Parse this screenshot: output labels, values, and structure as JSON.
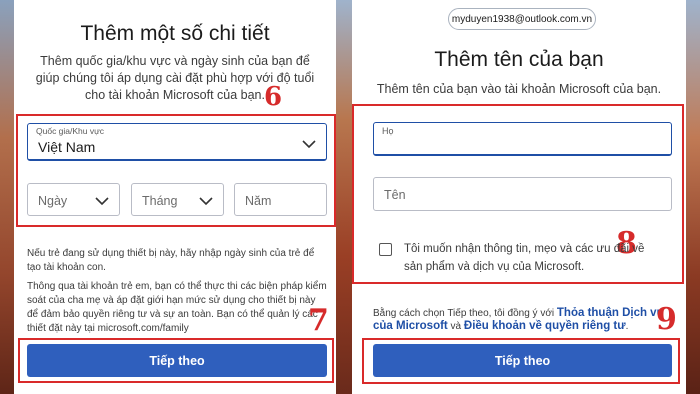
{
  "left": {
    "title": "Thêm một số chi tiết",
    "description": "Thêm quốc gia/khu vực và ngày sinh của bạn để giúp chúng tôi áp dụng cài đặt phù hợp với độ tuổi cho tài khoản Microsoft của bạn.",
    "country_label": "Quốc gia/Khu vực",
    "country_value": "Việt Nam",
    "day_placeholder": "Ngày",
    "month_placeholder": "Tháng",
    "year_placeholder": "Năm",
    "note1": "Nếu trẻ đang sử dụng thiết bị này, hãy nhập ngày sinh của trẻ để tạo tài khoản con.",
    "note2": "Thông qua tài khoản trẻ em, bạn có thể thực thi các biện pháp kiểm soát của cha mẹ và áp đặt giới hạn mức sử dụng cho thiết bị này để đảm bảo quyền riêng tư và sự an toàn. Bạn có thể quản lý các thiết đặt này tại microsoft.com/family",
    "next_button": "Tiếp theo",
    "step_a": "6",
    "step_b": "7"
  },
  "right": {
    "email": "myduyen1938@outlook.com.vn",
    "title": "Thêm tên của bạn",
    "description": "Thêm tên của bạn vào tài khoản Microsoft của bạn.",
    "last_name_placeholder": "Họ",
    "first_name_placeholder": "Tên",
    "checkbox_label": "Tôi muốn nhận thông tin, mẹo và các ưu đãi về sản phẩm và dịch vụ của Microsoft.",
    "terms_prefix": "Bằng cách chọn Tiếp theo, tôi đồng ý với ",
    "terms_link": "Thỏa thuận Dịch vụ của Microsoft",
    "terms_and": " và ",
    "privacy_link": "Điều khoản về quyền riêng tư",
    "terms_suffix": ".",
    "next_button": "Tiếp theo",
    "step_a": "8",
    "step_b": "9"
  },
  "colors": {
    "primary": "#2f5fbd",
    "link": "#1f4fa6",
    "highlight": "#d92a2a"
  }
}
